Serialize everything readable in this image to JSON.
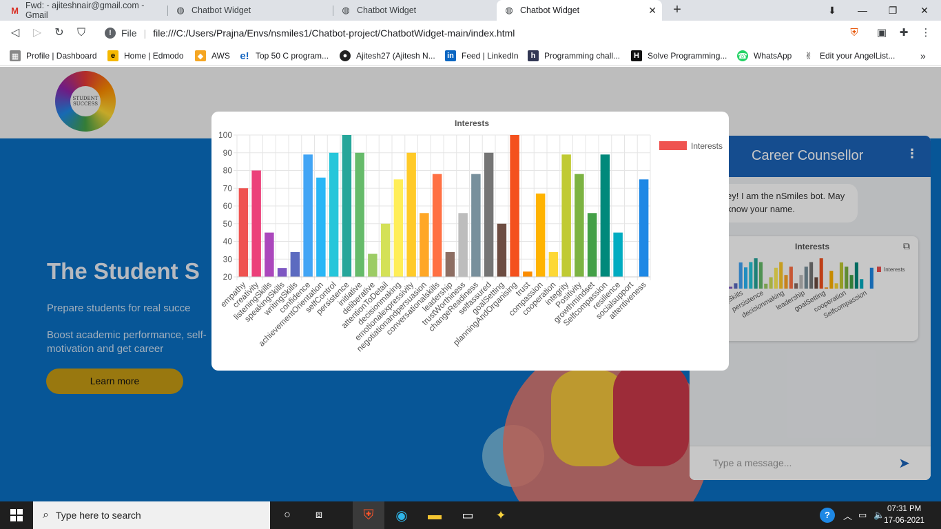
{
  "browser": {
    "tabs": [
      {
        "title": "Fwd: - ajiteshnair@gmail.com - Gmail",
        "icon": "gmail-icon"
      },
      {
        "title": "Chatbot Widget",
        "icon": "globe-icon"
      },
      {
        "title": "Chatbot Widget",
        "icon": "globe-icon"
      },
      {
        "title": "Chatbot Widget",
        "icon": "globe-icon",
        "active": true
      }
    ],
    "address": {
      "scheme_label": "File",
      "url": "file:///C:/Users/Prajna/Envs/nsmiles1/Chatbot-project/ChatbotWidget-main/index.html"
    },
    "bookmarks": [
      {
        "label": "Profile | Dashboard",
        "icon": "profile-icon"
      },
      {
        "label": "Home | Edmodo",
        "icon": "edmodo-icon"
      },
      {
        "label": "AWS",
        "icon": "aws-icon"
      },
      {
        "label": "Top 50 C program...",
        "icon": "e-icon"
      },
      {
        "label": "Ajitesh27 (Ajitesh N...",
        "icon": "github-icon"
      },
      {
        "label": "Feed | LinkedIn",
        "icon": "linkedin-icon"
      },
      {
        "label": "Programming chall...",
        "icon": "hackerearth-icon"
      },
      {
        "label": "Solve Programming...",
        "icon": "hackerrank-icon"
      },
      {
        "label": "WhatsApp",
        "icon": "whatsapp-icon"
      },
      {
        "label": "Edit your AngelList...",
        "icon": "angellist-icon"
      }
    ]
  },
  "site": {
    "logo_text": "STUDENT SUCCESS",
    "hero_title": "The Student S",
    "hero_sub": "Prepare students for real succe",
    "hero_sub2": "Boost academic performance, self-motivation and get career",
    "learn_more": "Learn more"
  },
  "chatbot": {
    "title": "Career Counsellor",
    "bot_message": "ey! I am the nSmiles bot. May know your name.",
    "card_title": "Interests",
    "card_legend": "Interests",
    "card_xlabels": [
      "y",
      "gSkills",
      "persistence",
      "decisionmaking",
      "leadership",
      "goalSetting",
      "cooperation",
      "Selfcompassion"
    ],
    "input_placeholder": "Type a message..."
  },
  "chart_data": {
    "type": "bar",
    "title": "Interests",
    "legend": "Interests",
    "legend_position": "right",
    "grid": true,
    "ylim": [
      20,
      100
    ],
    "yticks": [
      20,
      30,
      40,
      50,
      60,
      70,
      80,
      90,
      100
    ],
    "categories": [
      "empathy",
      "creativity",
      "listeningSkills",
      "speakingSkills",
      "writingSkills",
      "confidence",
      "achievementOrientation",
      "selfControl",
      "persistence",
      "initiative",
      "deliberative",
      "attentionToDetail",
      "decisionmaking",
      "emotionalexpressivity",
      "negotiationandpersuasion",
      "conversationalskills",
      "leadership",
      "trustWorthiness",
      "changeReadiness",
      "selfassured",
      "goalSetting",
      "planningAndOrganising",
      "trust",
      "compassion",
      "cooperation",
      "integrity",
      "Positivity",
      "growthmindset",
      "Selfcompassion",
      "resilience",
      "socialsupport",
      "attentiveness"
    ],
    "values": [
      70,
      80,
      45,
      25,
      34,
      89,
      76,
      90,
      100,
      90,
      33,
      50,
      75,
      90,
      56,
      78,
      34,
      56,
      78,
      90,
      50,
      100,
      23,
      67,
      34,
      89,
      78,
      56,
      89,
      45,
      20,
      75
    ],
    "colors": [
      "#ef5350",
      "#ec407a",
      "#ab47bc",
      "#7e57c2",
      "#5c6bc0",
      "#42a5f5",
      "#29b6f6",
      "#26c6da",
      "#26a69a",
      "#66bb6a",
      "#9ccc65",
      "#d4e157",
      "#ffee58",
      "#ffca28",
      "#ffa726",
      "#ff7043",
      "#8d6e63",
      "#bdbdbd",
      "#78909c",
      "#757575",
      "#6d4c41",
      "#f4511e",
      "#fb8c00",
      "#ffb300",
      "#fdd835",
      "#c0ca33",
      "#7cb342",
      "#43a047",
      "#00897b",
      "#00acc1",
      "#039be5",
      "#1e88e5"
    ],
    "legend_color": "#ef5350"
  },
  "taskbar": {
    "search_placeholder": "Type here to search",
    "time": "07:31 PM",
    "date": "17-06-2021"
  }
}
